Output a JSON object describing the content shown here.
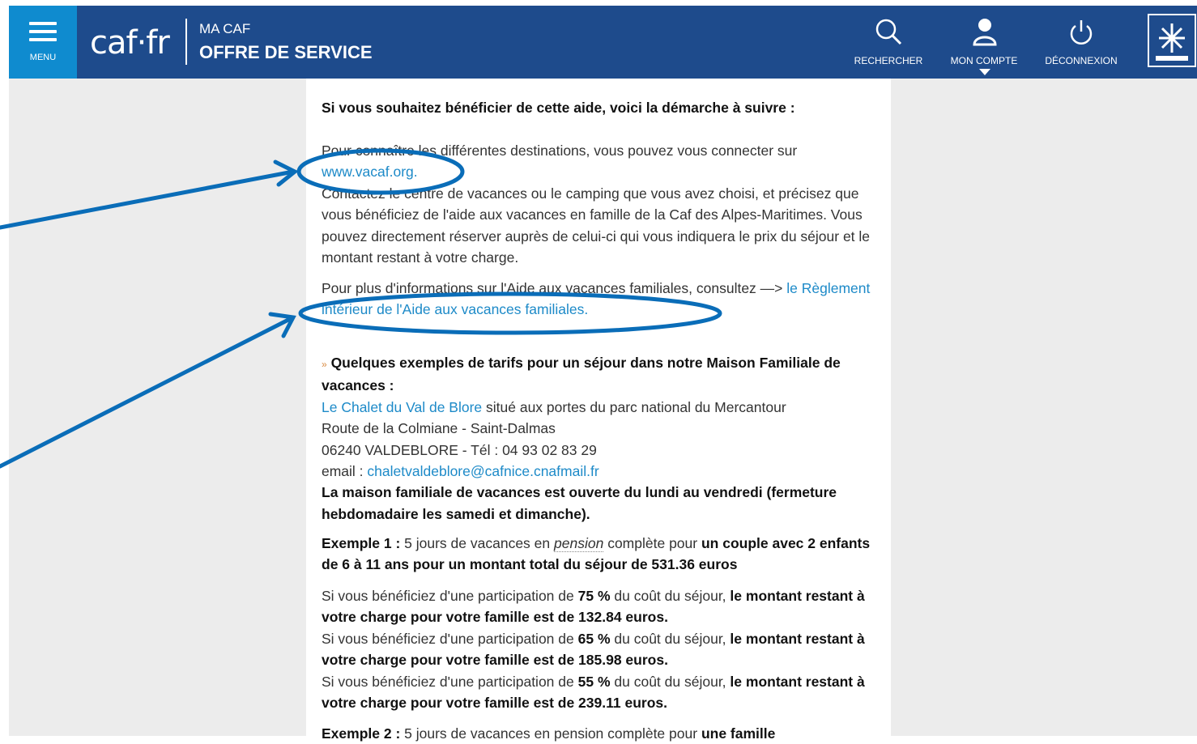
{
  "header": {
    "menu_label": "MENU",
    "logo": "caf·fr",
    "ma_caf": "MA CAF",
    "offre": "OFFRE DE SERVICE",
    "search_label": "RECHERCHER",
    "account_label": "MON COMPTE",
    "logout_label": "DÉCONNEXION",
    "accent_color": "#1e4b8c",
    "menu_color": "#0f8bcf",
    "icons": [
      "menu-icon",
      "search-icon",
      "account-icon",
      "power-icon",
      "caf-badge-icon"
    ]
  },
  "content": {
    "intro_heading": "Si vous souhaitez bénéficier de cette aide, voici la démarche à suivre :",
    "p1_text": "Pour connaître les différentes destinations, vous pouvez vous connecter sur",
    "p1_link": "www.vacaf.org.",
    "p2_text": "Contactez le centre de vacances ou le camping que vous avez choisi, et précisez que vous bénéficiez de l'aide aux vacances en famille de la Caf des Alpes-Maritimes. Vous pouvez directement réserver auprès de celui-ci qui vous indiquera le prix du séjour et le montant restant à votre charge.",
    "p3_text": "Pour plus d'informations sur l'Aide aux vacances familiales, consultez —>",
    "p3_link": "le Règlement intérieur de l'Aide aux vacances familiales.",
    "bullet": "»",
    "examples_heading": "Quelques exemples de tarifs pour un séjour dans notre Maison Familiale de vacances :",
    "chalet_link": "Le Chalet du Val de Blore",
    "chalet_text": "situé aux portes du parc national du Mercantour",
    "address1": "Route de la Colmiane - Saint-Dalmas",
    "address2": "06240 VALDEBLORE - Tél : 04 93 02 83 29",
    "email_label": "email :",
    "email_link": "chaletvaldeblore@cafnice.cnafmail.fr",
    "open_text": "La maison familiale de vacances est ouverte du lundi au vendredi (fermeture hebdomadaire les samedi et dimanche).",
    "ex1_label": "Exemple 1 :",
    "ex1_text_a": "5 jours de vacances en",
    "ex1_pension": "pension",
    "ex1_text_b": "complète pour",
    "ex1_bold": "un couple avec 2 enfants de 6 à 11 ans pour un montant total du séjour de 531.36 euros",
    "r1_a": "Si vous bénéficiez d'une participation de",
    "r1_pct": "75 %",
    "r1_b": "du coût du séjour,",
    "r1_bold": "le montant restant à votre charge pour votre famille est de 132.84 euros.",
    "r2_a": "Si vous bénéficiez d'une participation de",
    "r2_pct": "65 %",
    "r2_b": "du coût du séjour,",
    "r2_bold": "le montant restant à votre charge pour votre famille est de 185.98 euros.",
    "r3_a": "Si vous bénéficiez d'une participation de",
    "r3_pct": "55 %",
    "r3_b": "du coût du séjour,",
    "r3_bold": "le montant restant à votre charge pour votre famille est de 239.11 euros.",
    "ex2_label": "Exemple 2 :",
    "ex2_text": "5 jours de vacances en pension complète pour",
    "ex2_bold": "une famille"
  },
  "annotation_color": "#0a6db8"
}
